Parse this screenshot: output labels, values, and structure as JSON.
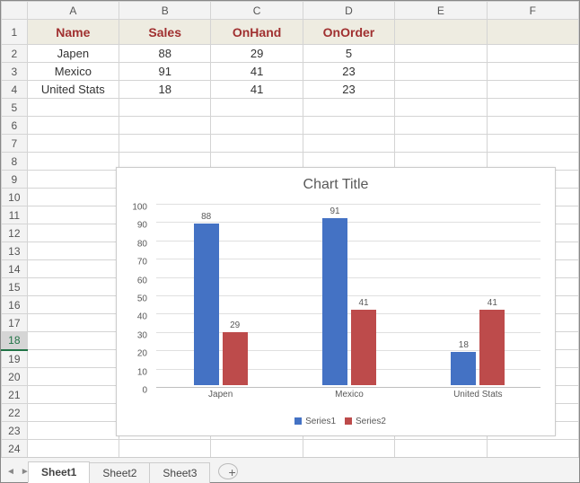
{
  "columns": [
    "A",
    "B",
    "C",
    "D",
    "E",
    "F"
  ],
  "rowcount": 24,
  "header_row": 1,
  "selected_row": 18,
  "table": {
    "headers": [
      "Name",
      "Sales",
      "OnHand",
      "OnOrder"
    ],
    "rows": [
      [
        "Japen",
        "88",
        "29",
        "5"
      ],
      [
        "Mexico",
        "91",
        "41",
        "23"
      ],
      [
        "United Stats",
        "18",
        "41",
        "23"
      ]
    ]
  },
  "chart_data": {
    "type": "bar",
    "title": "Chart Title",
    "categories": [
      "Japen",
      "Mexico",
      "United Stats"
    ],
    "series": [
      {
        "name": "Series1",
        "values": [
          88,
          91,
          18
        ],
        "color": "#4472c4"
      },
      {
        "name": "Series2",
        "values": [
          29,
          41,
          41
        ],
        "color": "#bd4b4b"
      }
    ],
    "ylim": [
      0,
      100
    ],
    "ystep": 10,
    "legend_position": "bottom"
  },
  "tabs": {
    "items": [
      "Sheet1",
      "Sheet2",
      "Sheet3"
    ],
    "active": 0,
    "newtab_glyph": "⊕"
  }
}
